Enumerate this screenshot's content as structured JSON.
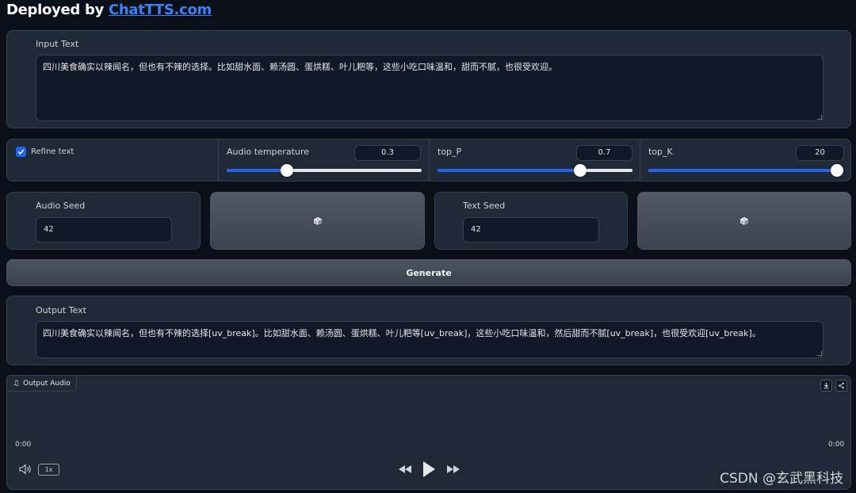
{
  "header": {
    "prefix": "Deployed by ",
    "link": "ChatTTS.com"
  },
  "input": {
    "label": "Input Text",
    "value": "四川美食确实以辣闻名，但也有不辣的选择。比如甜水面、赖汤圆、蛋烘糕、叶儿粑等，这些小吃口味温和，甜而不腻，也很受欢迎。"
  },
  "controls": {
    "refine_label": "Refine text",
    "refine_checked": true,
    "sliders": [
      {
        "label": "Audio temperature",
        "value": "0.3",
        "fraction": 0.31
      },
      {
        "label": "top_P",
        "value": "0.7",
        "fraction": 0.73
      },
      {
        "label": "top_K",
        "value": "20",
        "fraction": 1.0
      }
    ]
  },
  "seeds": {
    "audio_label": "Audio Seed",
    "audio_value": "42",
    "text_label": "Text Seed",
    "text_value": "42",
    "dice_icon": "dice-icon"
  },
  "generate_label": "Generate",
  "output": {
    "label": "Output Text",
    "value": "四川美食确实以辣闻名，但也有不辣的选择[uv_break]。比如甜水面、赖汤圆、蛋烘糕、叶儿粑等[uv_break]，这些小吃口味温和，然后甜而不腻[uv_break]，也很受欢迎[uv_break]。"
  },
  "audio": {
    "label": "Output Audio",
    "time_start": "0:00",
    "time_end": "0:00",
    "speed": "1x"
  },
  "watermark": "CSDN @玄武黑科技",
  "colors": {
    "background": "#0b0f19",
    "panel": "#1f2937",
    "accent": "#2563eb",
    "link": "#3b82f6"
  }
}
